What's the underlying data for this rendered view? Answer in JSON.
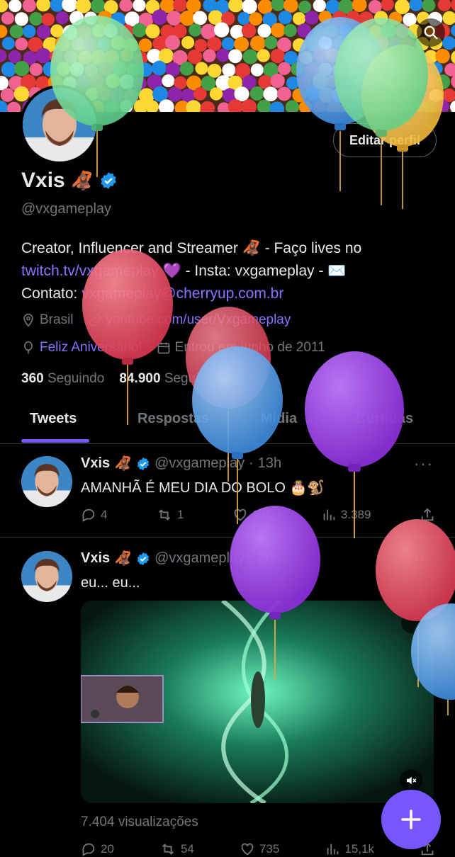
{
  "profile": {
    "name": "Vxis",
    "name_emoji": "🦧",
    "handle": "@vxgameplay",
    "edit_label": "Editar perfil",
    "bio_line1": "Creator, Influencer and Streamer 🦧 - Faço lives no",
    "bio_link1": "twitch.tv/vxgameplay",
    "bio_line2_rest": " 💜 - Insta: vxgameplay - ✉️",
    "bio_contact_label": "Contato: ",
    "bio_email": "vxgameplay@cherryup.com.br",
    "location": "Brasil",
    "website": "youtube.com/user/Vxgameplay",
    "birthday": "Feliz Aniversário!",
    "joined": "Entrou em junho de 2011",
    "following_count": "360",
    "following_label": "Seguindo",
    "followers_count": "84.900",
    "followers_label": "Seguidores"
  },
  "tabs": [
    "Tweets",
    "Respostas",
    "Mídia",
    "Curtidas"
  ],
  "tweets": [
    {
      "name": "Vxis",
      "emoji": "🦧",
      "handle": "@vxgameplay",
      "time": "13h",
      "text": "AMANHÃ É MEU DIA DO BOLO 🎂🐒",
      "replies": "4",
      "retweets": "1",
      "likes": "145",
      "views": "3.389"
    },
    {
      "name": "Vxis",
      "emoji": "🦧",
      "handle": "@vxgameplay",
      "time": "2d",
      "text": "eu... eu...",
      "view_count_text": "7.404 visualizações",
      "replies": "20",
      "retweets": "54",
      "likes": "735",
      "views": "15,1k"
    }
  ],
  "colors": {
    "accent": "#7856ff",
    "link": "#8b72ff",
    "muted": "#71767b",
    "verified": "#1d9bf0"
  },
  "icons": [
    "search-icon",
    "verified-badge-icon",
    "location-icon",
    "link-icon",
    "balloon-icon",
    "calendar-icon",
    "reply-icon",
    "retweet-icon",
    "like-icon",
    "views-icon",
    "share-icon",
    "more-icon",
    "mute-icon",
    "compose-plus-icon"
  ]
}
